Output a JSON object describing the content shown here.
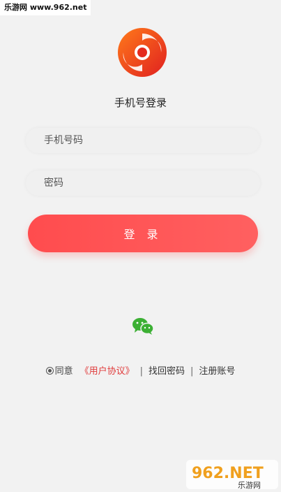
{
  "watermark_top": "乐游网 www.962.net",
  "header": {
    "title": "手机号登录"
  },
  "form": {
    "phone_placeholder": "手机号码",
    "password_placeholder": "密码",
    "login_label": "登 录"
  },
  "footer": {
    "agree": "同意",
    "agreement": "《用户协议》",
    "separator": "|",
    "forgot": "找回密码",
    "register": "注册账号"
  },
  "watermark_bottom": {
    "big": "962.NET",
    "small": "乐游网"
  },
  "colors": {
    "accent": "#ff5252",
    "background": "#f2f2f2",
    "wechat": "#3cb034"
  },
  "icons": {
    "logo": "swirl-logo-icon",
    "wechat": "wechat-icon"
  }
}
